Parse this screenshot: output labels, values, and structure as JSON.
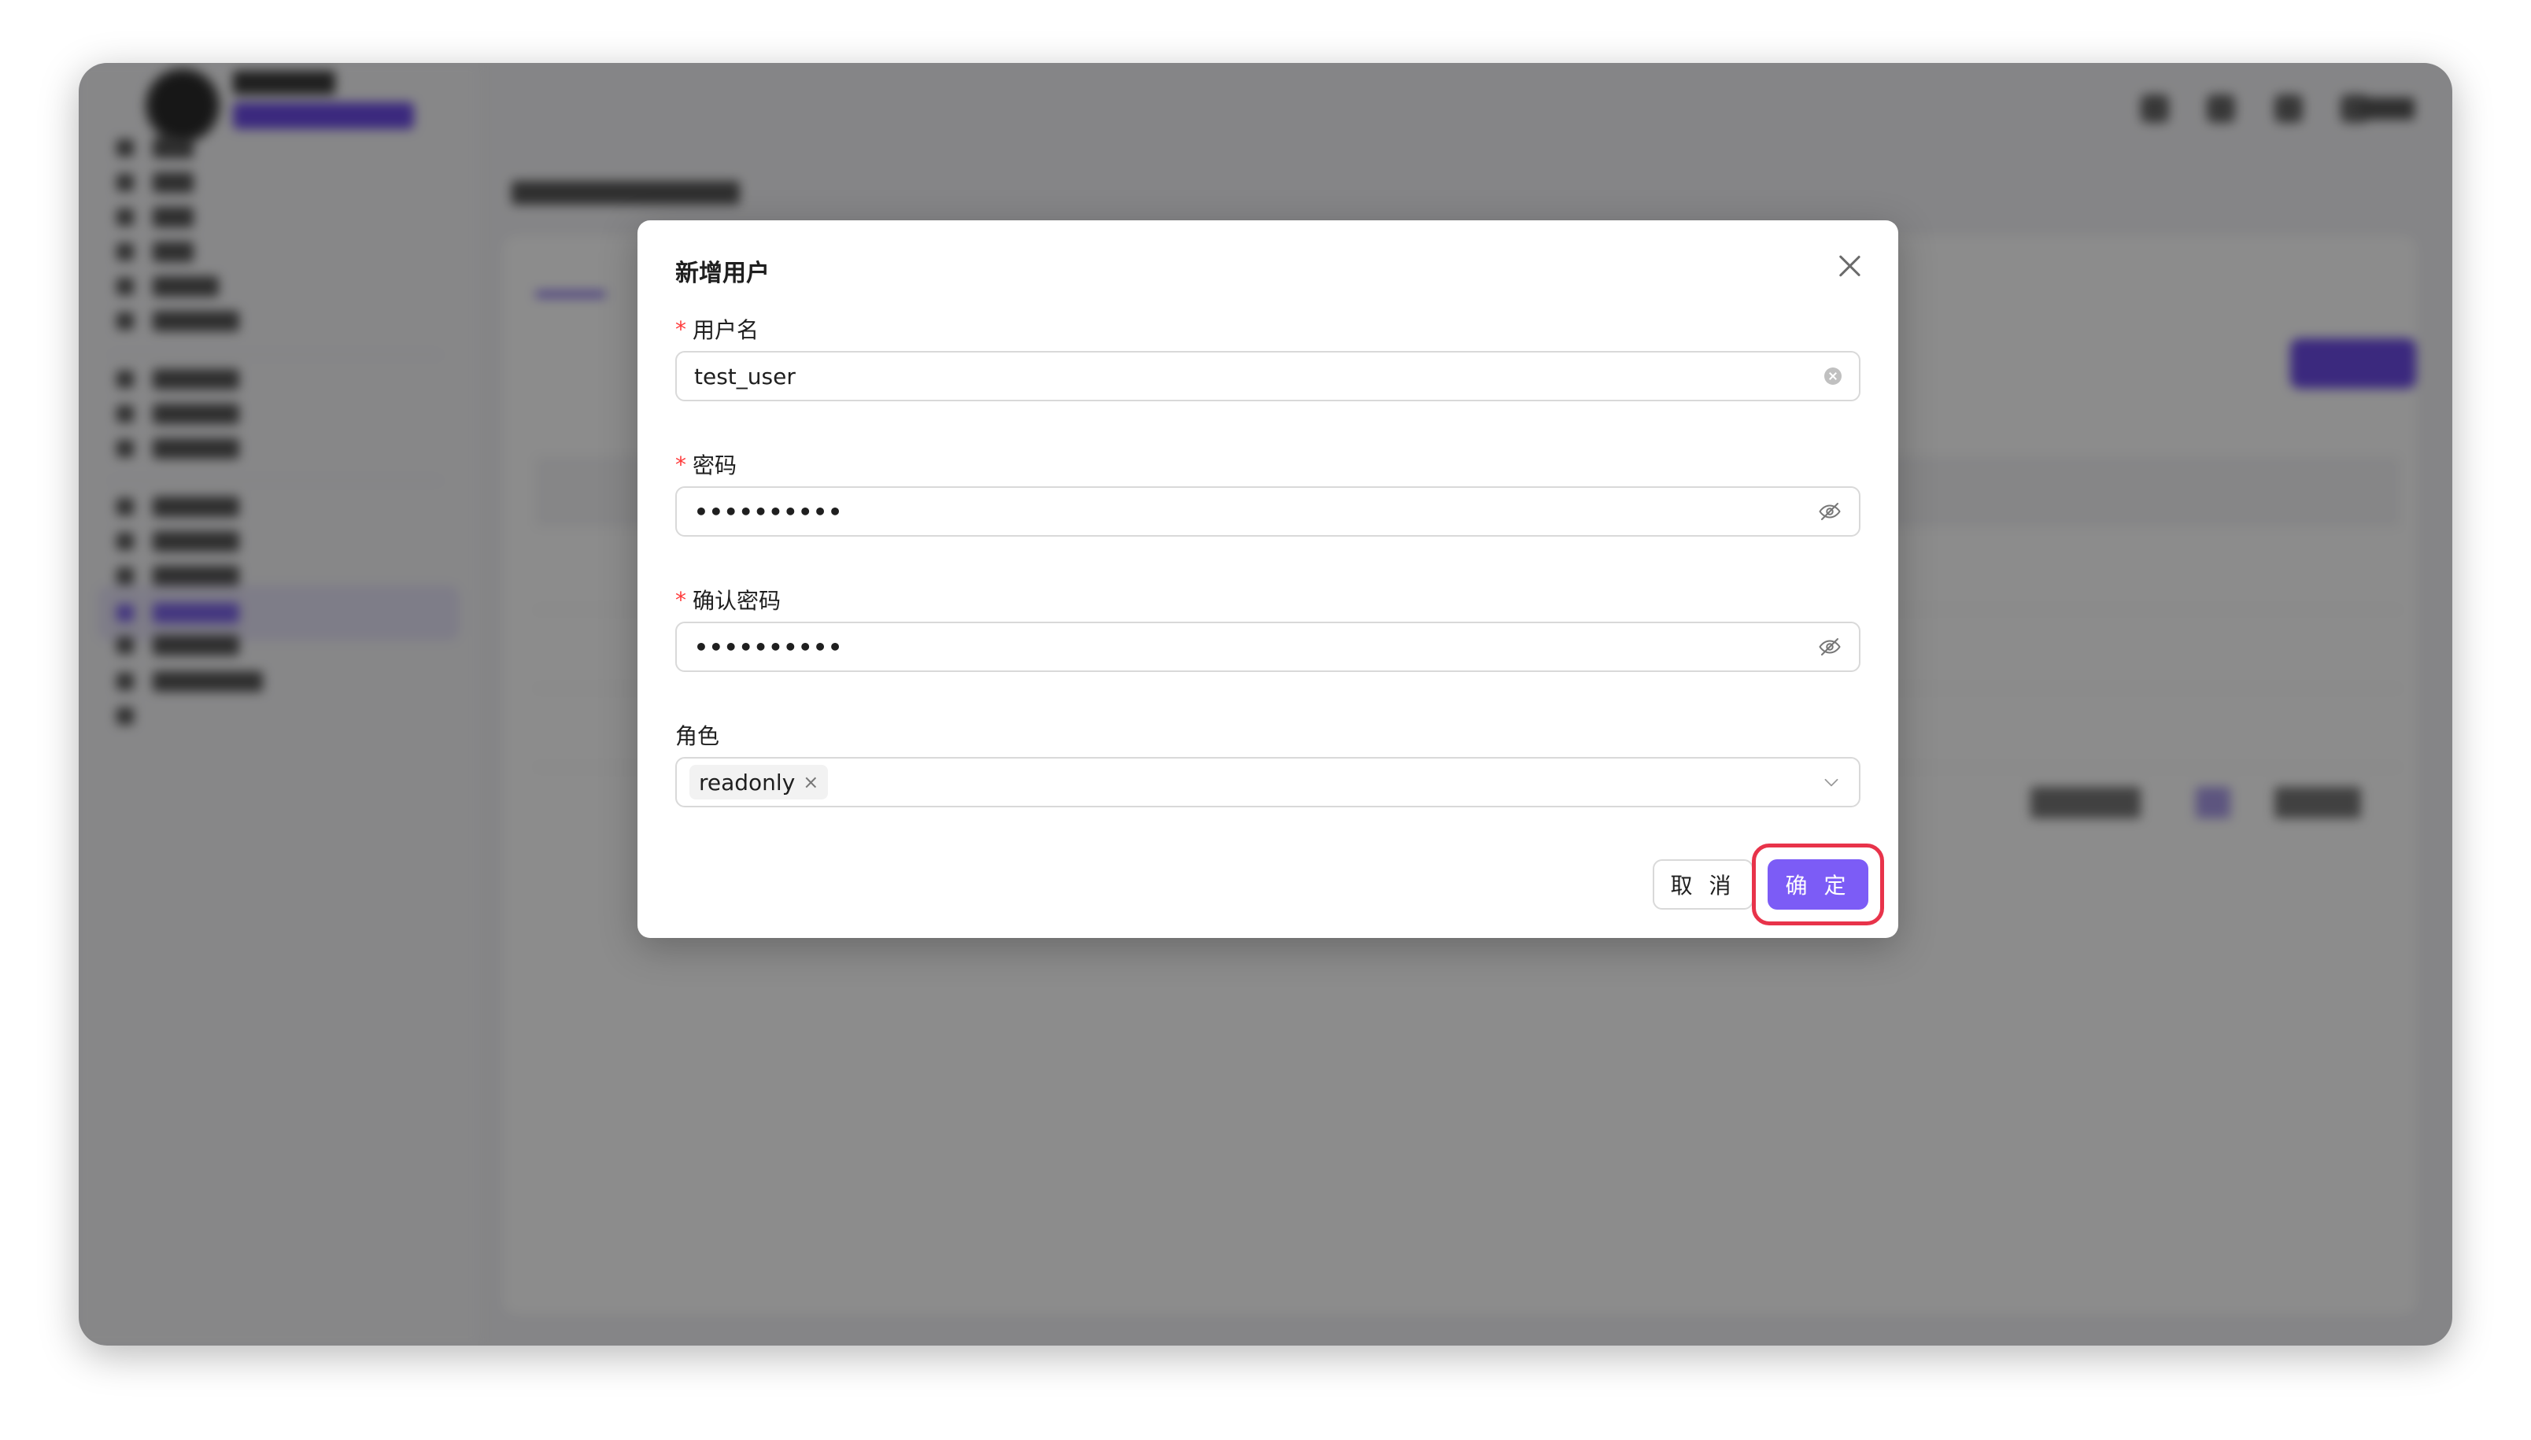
{
  "modal": {
    "title": "新增用户",
    "username": {
      "label": "用户名",
      "required": true,
      "value": "test_user"
    },
    "password": {
      "label": "密码",
      "required": true,
      "masked_value": "••••••••••"
    },
    "confirm_password": {
      "label": "确认密码",
      "required": true,
      "masked_value": "••••••••••"
    },
    "role": {
      "label": "角色",
      "selected": [
        "readonly"
      ]
    },
    "cancel_label": "取 消",
    "ok_label": "确 定"
  },
  "icons": {
    "close": "close-icon",
    "clear": "clear-icon",
    "password_toggle": "eye-off-icon",
    "dropdown": "chevron-down-icon",
    "tag_remove": "close-icon"
  },
  "colors": {
    "primary": "#7c5cf6",
    "required_marker": "#ff3b3b",
    "highlight_ring": "#e8334a",
    "overlay": "rgba(0,0,0,0.45)"
  }
}
